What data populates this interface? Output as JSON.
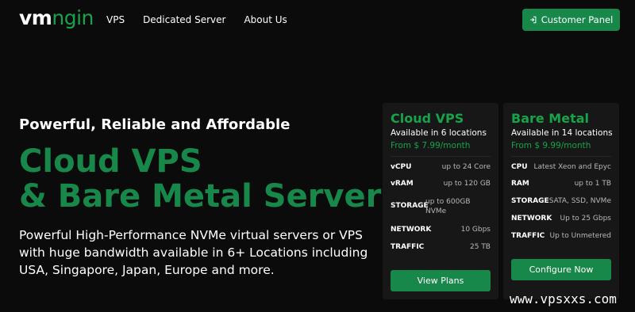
{
  "header": {
    "logo_vm": "vm",
    "logo_ngin": "ngin",
    "nav": [
      "VPS",
      "Dedicated Server",
      "About Us"
    ],
    "cta_label": "Customer Panel",
    "cta_icon": "login-icon"
  },
  "hero": {
    "subtitle": "Powerful, Reliable and Affordable",
    "title_line1": "Cloud VPS",
    "title_line2": "& Bare Metal Servers",
    "description": "Powerful High-Performance NVMe virtual servers or VPS with huge bandwidth available in 6+ Locations including USA, Singapore, Japan, Europe and more."
  },
  "cards": [
    {
      "title": "Cloud VPS",
      "availability": "Available in 6 locations",
      "price": "From $ 7.99/month",
      "specs": [
        {
          "label": "vCPU",
          "value": "up to 24 Core"
        },
        {
          "label": "vRAM",
          "value": "up to 120 GB"
        },
        {
          "label": "STORAGE",
          "value": "up to 600GB NVMe"
        },
        {
          "label": "NETWORK",
          "value": "10 Gbps"
        },
        {
          "label": "TRAFFIC",
          "value": "25 TB"
        }
      ],
      "button": "View Plans"
    },
    {
      "title": "Bare Metal",
      "availability": "Available in 14 locations",
      "price": "From $ 9.99/month",
      "specs": [
        {
          "label": "CPU",
          "value": "Latest Xeon and Epyc"
        },
        {
          "label": "RAM",
          "value": "up to 1 TB"
        },
        {
          "label": "STORAGE",
          "value": "SATA, SSD, NVMe"
        },
        {
          "label": "NETWORK",
          "value": "Up to 25 Gbps"
        },
        {
          "label": "TRAFFIC",
          "value": "Up to Unmetered"
        }
      ],
      "button": "Configure Now"
    }
  ],
  "watermark": "www.vpsxxs.com",
  "colors": {
    "background": "#0b0b0b",
    "accent": "#17884a",
    "accent_text": "#17a34a",
    "card": "#171717"
  }
}
